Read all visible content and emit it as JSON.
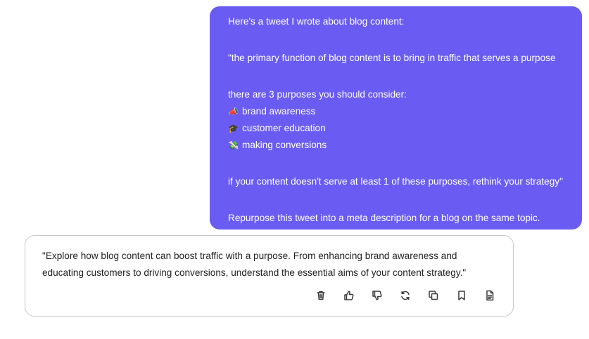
{
  "user_message": {
    "lines": [
      "Here's a tweet I wrote about blog content:",
      "\"the primary function of blog content is to bring in traffic that serves a purpose",
      "there are 3 purposes you should consider:",
      "brand awareness",
      "customer education",
      "making conversions",
      "if your content doesn't serve at least 1 of these purposes, rethink your strategy\"",
      "Repurpose this tweet into a meta description for a blog on the same topic."
    ],
    "bullet_emojis": [
      "📣",
      "🎓",
      "💸"
    ]
  },
  "assistant_message": {
    "lines": [
      "\"Explore how blog content can boost traffic with a purpose. From enhancing brand awareness and",
      "educating customers to driving conversions, understand the essential aims of your content strategy.\""
    ],
    "actions": [
      "delete-icon",
      "thumbs-up-icon",
      "thumbs-down-icon",
      "regenerate-icon",
      "copy-icon",
      "bookmark-icon",
      "document-icon"
    ]
  },
  "colors": {
    "user_bubble_bg": "#6a5cf2",
    "user_text": "#ffffff",
    "assistant_border": "#c9c9c9",
    "assistant_text": "#222222"
  }
}
